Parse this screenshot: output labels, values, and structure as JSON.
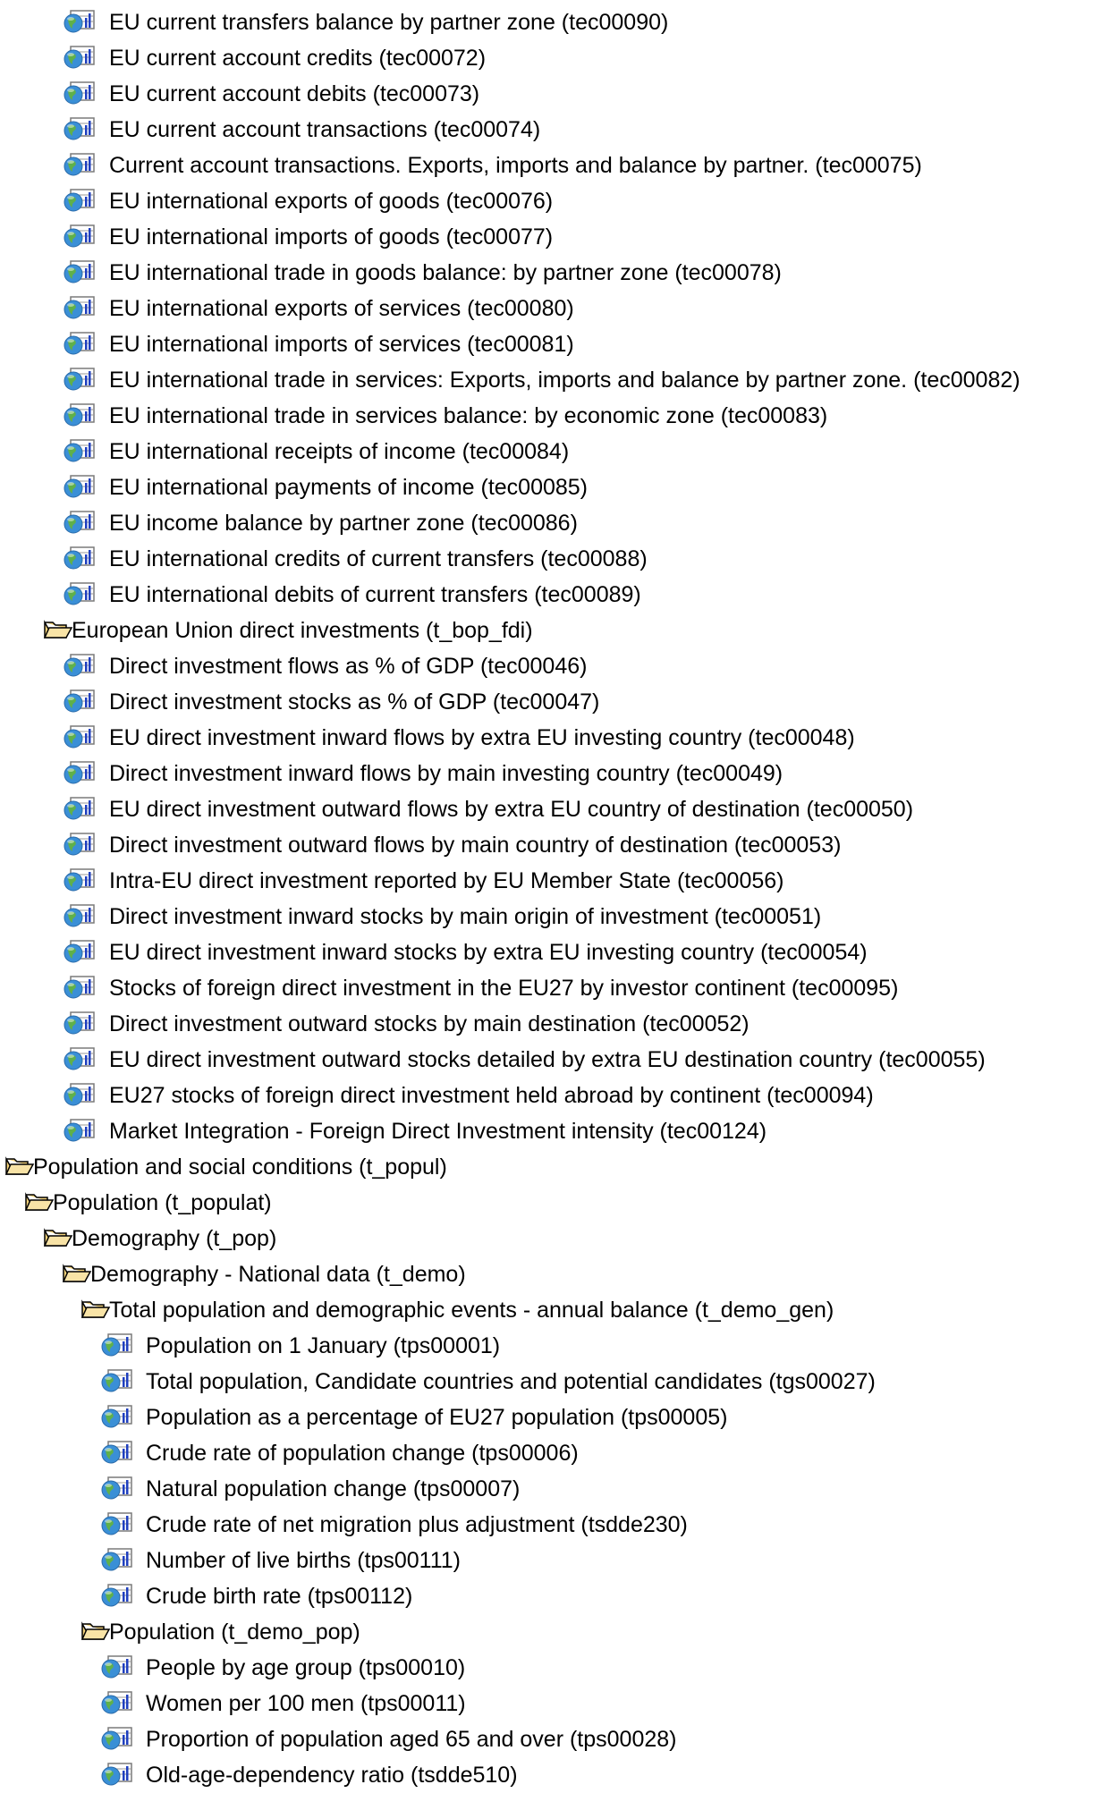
{
  "tree": {
    "nodes": [
      {
        "type": "table",
        "level": 0,
        "label": "EU current transfers balance by partner zone (tec00090)"
      },
      {
        "type": "table",
        "level": 0,
        "label": "EU current account credits (tec00072)"
      },
      {
        "type": "table",
        "level": 0,
        "label": "EU current account debits (tec00073)"
      },
      {
        "type": "table",
        "level": 0,
        "label": "EU current account transactions (tec00074)"
      },
      {
        "type": "table",
        "level": 0,
        "label": "Current account transactions. Exports, imports and balance by partner. (tec00075)"
      },
      {
        "type": "table",
        "level": 0,
        "label": "EU international exports of goods (tec00076)"
      },
      {
        "type": "table",
        "level": 0,
        "label": "EU international imports of goods (tec00077)"
      },
      {
        "type": "table",
        "level": 0,
        "label": "EU international trade in goods balance: by partner zone (tec00078)"
      },
      {
        "type": "table",
        "level": 0,
        "label": "EU international exports of services (tec00080)"
      },
      {
        "type": "table",
        "level": 0,
        "label": "EU international imports of services (tec00081)"
      },
      {
        "type": "table",
        "level": 0,
        "label": "EU international trade in services: Exports, imports and balance by partner zone. (tec00082)"
      },
      {
        "type": "table",
        "level": 0,
        "label": "EU international trade in services balance: by economic zone (tec00083)"
      },
      {
        "type": "table",
        "level": 0,
        "label": "EU international receipts of income (tec00084)"
      },
      {
        "type": "table",
        "level": 0,
        "label": "EU international payments of income (tec00085)"
      },
      {
        "type": "table",
        "level": 0,
        "label": "EU income balance by partner zone (tec00086)"
      },
      {
        "type": "table",
        "level": 0,
        "label": "EU international credits of current transfers (tec00088)"
      },
      {
        "type": "table",
        "level": 0,
        "label": "EU international debits of current transfers (tec00089)"
      },
      {
        "type": "folder",
        "level": 2,
        "label": "European Union direct investments (t_bop_fdi)"
      },
      {
        "type": "table",
        "level": 0,
        "label": "Direct investment flows as % of GDP (tec00046)"
      },
      {
        "type": "table",
        "level": 0,
        "label": "Direct investment stocks as % of GDP (tec00047)"
      },
      {
        "type": "table",
        "level": 0,
        "label": "EU direct investment inward flows by extra EU investing country (tec00048)"
      },
      {
        "type": "table",
        "level": 0,
        "label": "Direct investment inward flows by main investing country (tec00049)"
      },
      {
        "type": "table",
        "level": 0,
        "label": "EU direct investment outward flows by extra EU country of destination (tec00050)"
      },
      {
        "type": "table",
        "level": 0,
        "label": "Direct investment outward flows by main country of destination (tec00053)"
      },
      {
        "type": "table",
        "level": 0,
        "label": "Intra-EU direct investment reported by EU Member State  (tec00056)"
      },
      {
        "type": "table",
        "level": 0,
        "label": "Direct investment inward stocks by main origin of investment (tec00051)"
      },
      {
        "type": "table",
        "level": 0,
        "label": "EU direct investment inward stocks by extra EU investing country (tec00054)"
      },
      {
        "type": "table",
        "level": 0,
        "label": "Stocks of foreign direct investment in the EU27 by investor continent (tec00095)"
      },
      {
        "type": "table",
        "level": 0,
        "label": "Direct investment outward stocks by main destination (tec00052)"
      },
      {
        "type": "table",
        "level": 0,
        "label": "EU direct investment outward stocks detailed by extra EU destination country (tec00055)"
      },
      {
        "type": "table",
        "level": 0,
        "label": "EU27 stocks of foreign direct investment held abroad by continent  (tec00094)"
      },
      {
        "type": "table",
        "level": 0,
        "label": "Market Integration - Foreign Direct Investment intensity (tec00124)"
      },
      {
        "type": "folder",
        "level": 0,
        "label": "Population and social conditions (t_popul)"
      },
      {
        "type": "folder",
        "level": 1,
        "label": "Population (t_populat)"
      },
      {
        "type": "folder",
        "level": 2,
        "label": "Demography (t_pop)"
      },
      {
        "type": "folder",
        "level": 3,
        "label": "Demography - National data (t_demo)"
      },
      {
        "type": "folder",
        "level": 4,
        "label": "Total population and demographic events - annual balance (t_demo_gen)"
      },
      {
        "type": "table",
        "level": 1,
        "label": "Population on 1 January (tps00001)"
      },
      {
        "type": "table",
        "level": 1,
        "label": "Total population, Candidate countries and potential candidates (tgs00027)"
      },
      {
        "type": "table",
        "level": 1,
        "label": "Population as a percentage of EU27 population (tps00005)"
      },
      {
        "type": "table",
        "level": 1,
        "label": "Crude rate of population change (tps00006)"
      },
      {
        "type": "table",
        "level": 1,
        "label": "Natural population change (tps00007)"
      },
      {
        "type": "table",
        "level": 1,
        "label": "Crude rate of net migration plus adjustment (tsdde230)"
      },
      {
        "type": "table",
        "level": 1,
        "label": "Number of live births (tps00111)"
      },
      {
        "type": "table",
        "level": 1,
        "label": "Crude birth rate (tps00112)"
      },
      {
        "type": "folder",
        "level": 4,
        "label": "Population (t_demo_pop)"
      },
      {
        "type": "table",
        "level": 1,
        "label": "People by age group (tps00010)"
      },
      {
        "type": "table",
        "level": 1,
        "label": "Women per 100 men (tps00011)"
      },
      {
        "type": "table",
        "level": 1,
        "label": "Proportion of population aged 65 and over (tps00028)"
      },
      {
        "type": "table",
        "level": 1,
        "label": "Old-age-dependency ratio (tsdde510)"
      }
    ]
  },
  "icons": {
    "table": "dataset-table-icon",
    "folder": "open-folder-icon"
  },
  "colors": {
    "folder_fill": "#f3d27a",
    "folder_stroke": "#000000",
    "globe": "#3a8fd6",
    "globe_land": "#5fb04a",
    "chart_bars": "#1f3fbf"
  }
}
